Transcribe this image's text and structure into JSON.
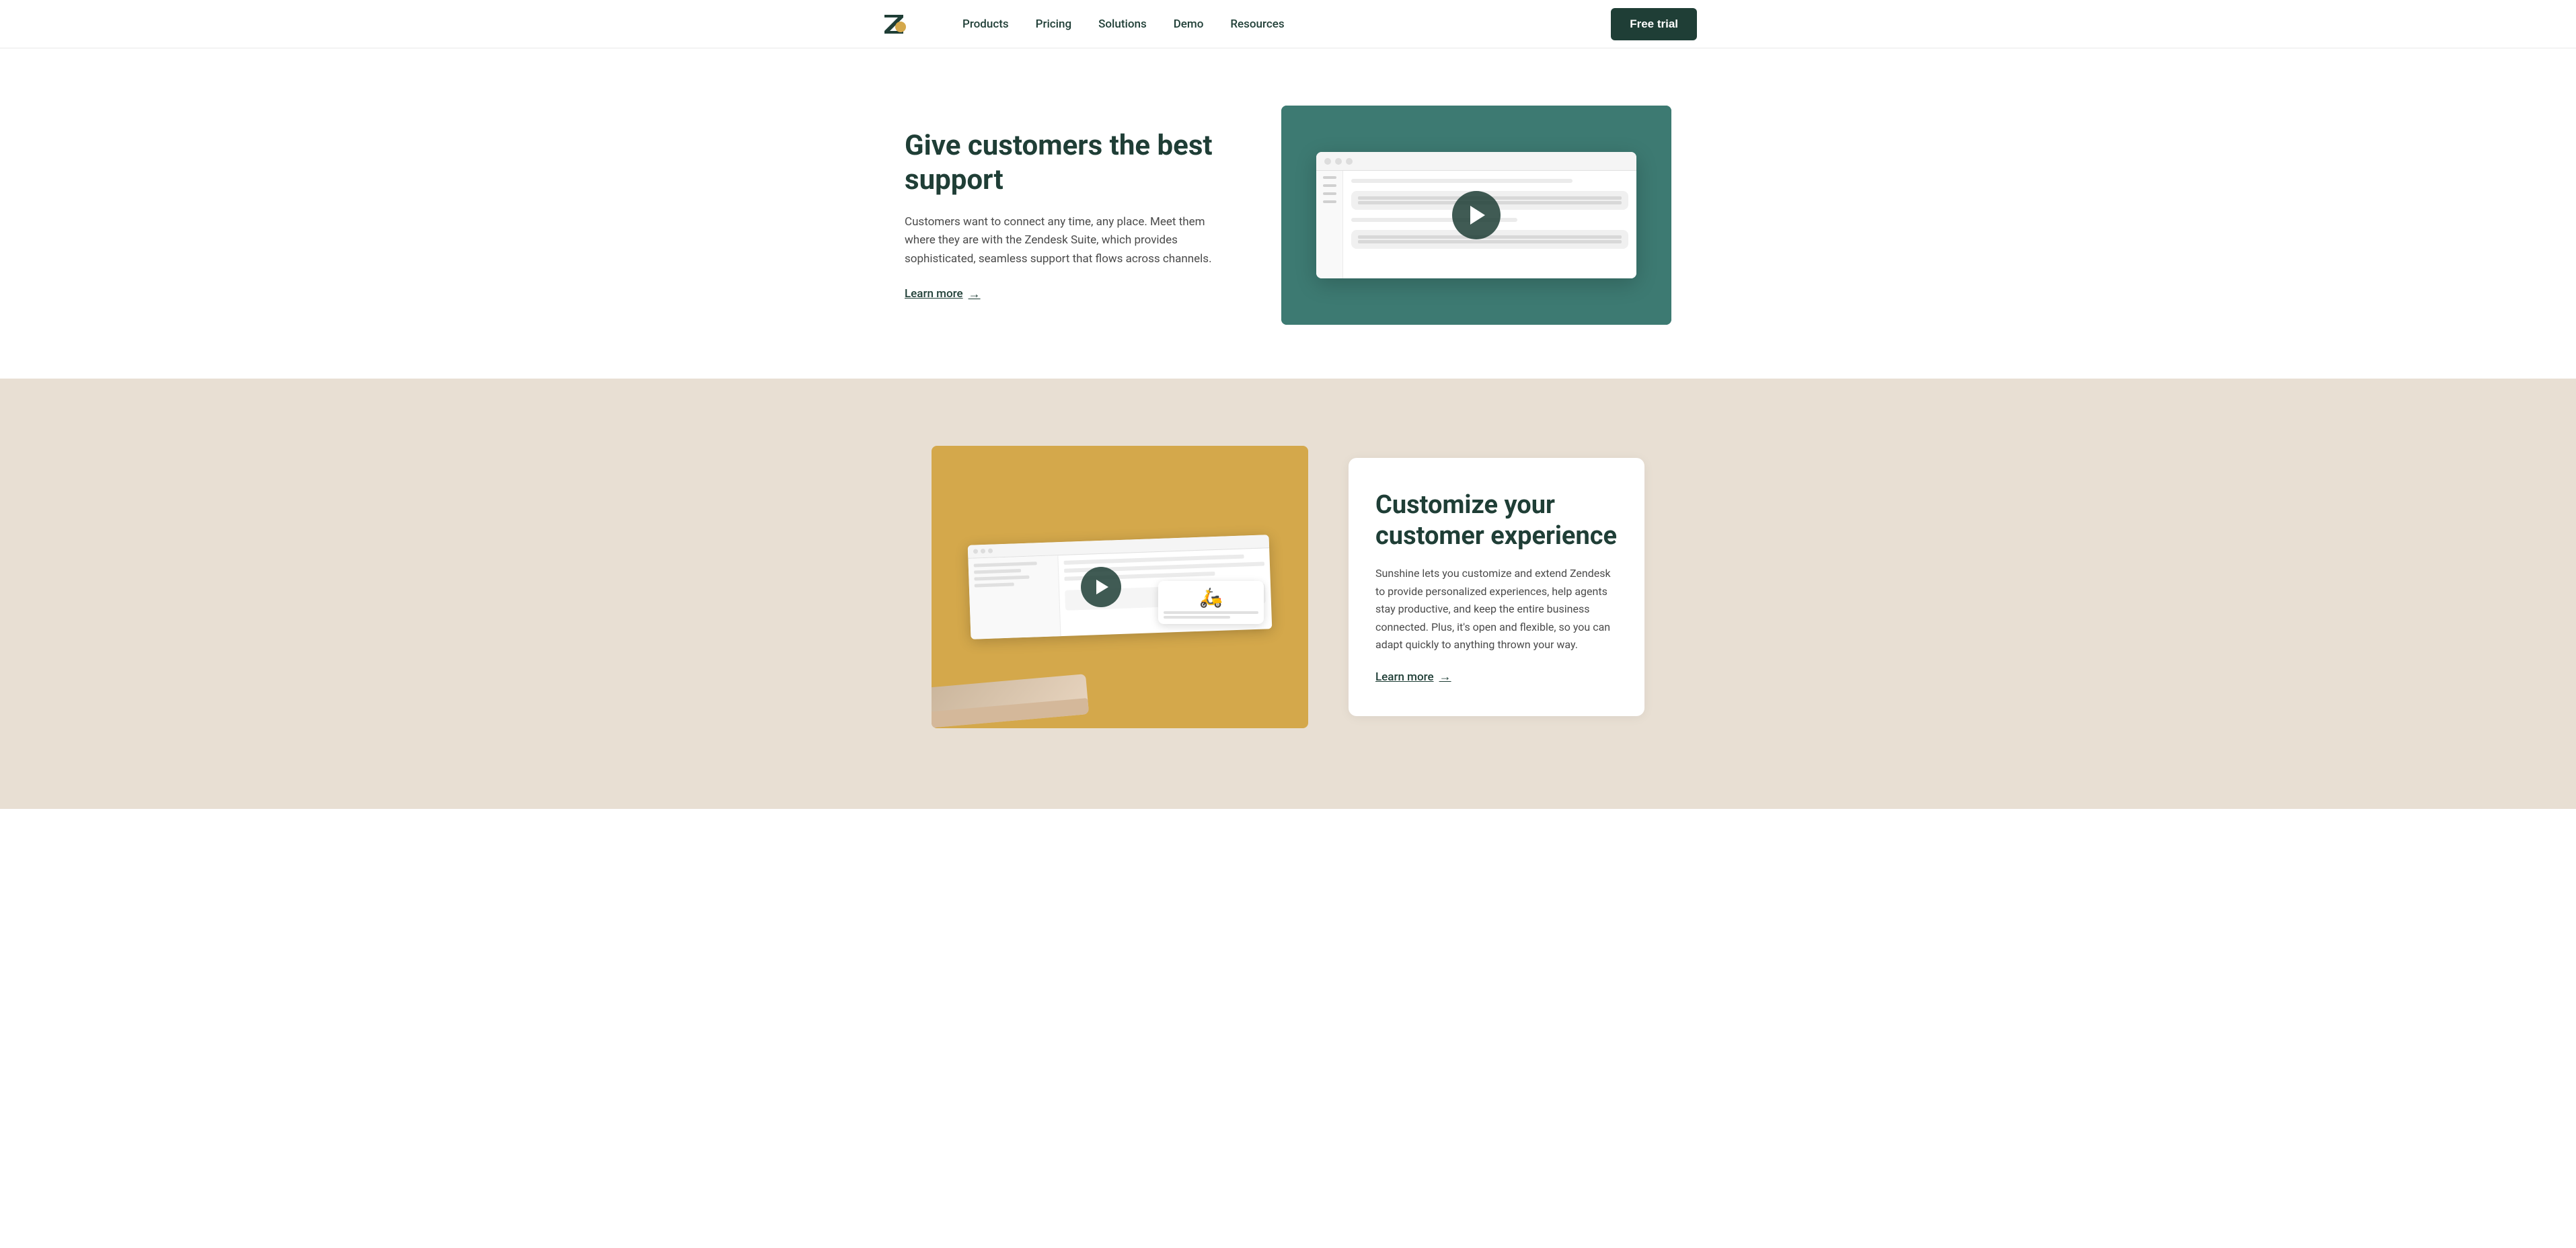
{
  "topAccent": {
    "color": "#3d7a72"
  },
  "navbar": {
    "logo": "zendesk-logo",
    "links": [
      {
        "id": "products",
        "label": "Products"
      },
      {
        "id": "pricing",
        "label": "Pricing"
      },
      {
        "id": "solutions",
        "label": "Solutions"
      },
      {
        "id": "demo",
        "label": "Demo"
      },
      {
        "id": "resources",
        "label": "Resources"
      }
    ],
    "cta": {
      "label": "Free trial"
    }
  },
  "sectionSupport": {
    "heading": "Give customers the best support",
    "body": "Customers want to connect any time, any place. Meet them where they are with the Zendesk Suite, which provides sophisticated, seamless support that flows across channels.",
    "learnMore": "Learn more",
    "videoAlt": "Zendesk support product demo video thumbnail"
  },
  "sectionCustomize": {
    "card": {
      "heading": "Customize your customer experience",
      "body": "Sunshine lets you customize and extend Zendesk to provide personalized experiences, help agents stay productive, and keep the entire business connected. Plus, it's open and flexible, so you can adapt quickly to anything thrown your way.",
      "learnMore": "Learn more"
    },
    "imageAlt": "Zendesk Sunshine product demo"
  },
  "icons": {
    "arrow": "→",
    "play": "▶",
    "scooter": "🛵"
  }
}
